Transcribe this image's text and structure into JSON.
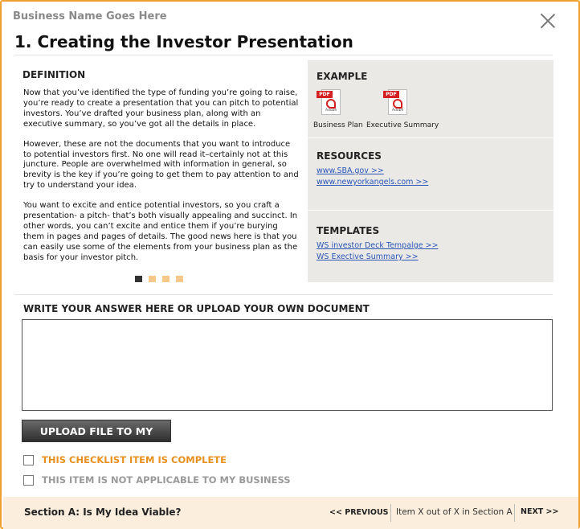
{
  "header": {
    "business_name": "Business Name Goes Here",
    "title": "1. Creating the Investor Presentation"
  },
  "definition": {
    "heading": "DEFINITION",
    "paragraphs": [
      "Now that you’ve identified the type of funding you’re going to raise, you’re ready to create a presentation that you can pitch to potential investors. You’ve drafted your business plan, along with an executive summary, so you’ve got all the details in place.",
      "However, these are not the documents that you want to introduce to potential investors first.  No one will read it–certainly not at this juncture. People are overwhelmed with information in general, so brevity is the key if you’re going to get them to pay attention to and try to understand your idea.",
      "You want to excite and entice potential investors, so you craft a presentation- a pitch- that’s both visually appealing and succinct. In other words, you can’t excite and entice them if you’re burying them in pages and pages of details.  The good news here is that you can easily use some of the elements from your business plan as the basis for your investor pitch."
    ],
    "pager": {
      "total": 4,
      "current": 1
    }
  },
  "example": {
    "heading": "EXAMPLE",
    "files": [
      {
        "label": "Business Plan",
        "icon": "pdf-icon",
        "badge": "PDF",
        "brand": "Adobe"
      },
      {
        "label": "Executive Summary",
        "icon": "pdf-icon",
        "badge": "PDF",
        "brand": "Adobe"
      }
    ]
  },
  "resources": {
    "heading": "RESOURCES",
    "links": [
      "www.SBA.gov >>",
      "www.newyorkangels.com >>"
    ]
  },
  "templates": {
    "heading": "TEMPLATES",
    "links": [
      "WS investor Deck Tempalge >>",
      "WS Exective Summary >>"
    ]
  },
  "answer": {
    "heading": "WRITE YOUR ANSWER HERE OR UPLOAD YOUR OWN DOCUMENT",
    "value": "",
    "upload_label": "UPLOAD FILE TO MY DOCS"
  },
  "checklist": {
    "complete_label": "THIS CHECKLIST ITEM IS COMPLETE",
    "complete_checked": false,
    "na_label": "THIS  ITEM IS NOT APPLICABLE TO MY BUSINESS",
    "na_checked": false
  },
  "footer": {
    "section": "Section A: Is My Idea Viable?",
    "prev_label": "<< PREVIOUS",
    "item_status": "Item X out of X in Section A",
    "next_label": "NEXT >>"
  },
  "colors": {
    "frame": "#f0a030",
    "checklist_complete": "#e8901e",
    "checklist_na": "#9a9a9a",
    "link": "#2a56b8",
    "footer_bg": "#fbeedd",
    "side_bg": "#ebe9e6"
  }
}
